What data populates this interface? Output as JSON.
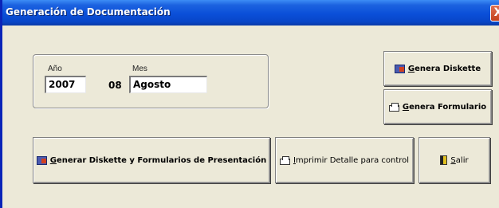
{
  "window": {
    "title": "Generación de Documentación",
    "close_label": "X"
  },
  "period": {
    "year_label": "Año",
    "year_value": "2007",
    "month_label": "Mes",
    "month_number": "08",
    "month_name": "Agosto"
  },
  "buttons": {
    "genera_diskette": {
      "first": "G",
      "rest": "enera Diskette"
    },
    "genera_formulario": {
      "first": "G",
      "rest": "enera Formulario"
    },
    "generar_todo": {
      "first": "G",
      "rest": "enerar Diskette y Formularios de Presentación"
    },
    "imprimir": {
      "first": "I",
      "rest": "mprimir Detalle para control"
    },
    "salir": {
      "first": "S",
      "rest": "alir"
    }
  },
  "icons": {
    "disk": "diskette-icon",
    "printer": "printer-icon",
    "exit": "exit-door-icon"
  },
  "colors": {
    "titlebar": "#0a4fd8",
    "window_bg": "#ece9d8",
    "close_button": "#c4401c"
  }
}
